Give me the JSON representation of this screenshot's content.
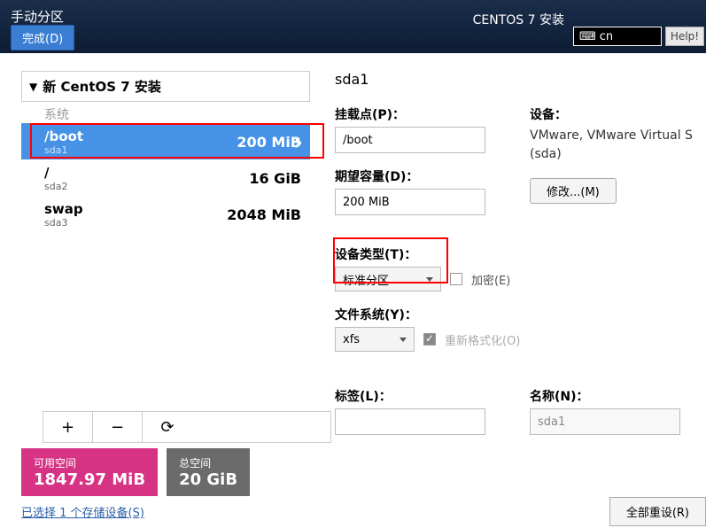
{
  "topbar": {
    "title": "手动分区",
    "done": "完成(D)",
    "installer": "CENTOS 7 安装",
    "lang": "cn",
    "help": "Help!"
  },
  "left": {
    "header": "新 CentOS 7 安装",
    "sys": "系统",
    "parts": [
      {
        "name": "/boot",
        "dev": "sda1",
        "size": "200 MiB",
        "selected": true
      },
      {
        "name": "/",
        "dev": "sda2",
        "size": "16 GiB",
        "selected": false
      },
      {
        "name": "swap",
        "dev": "sda3",
        "size": "2048 MiB",
        "selected": false
      }
    ],
    "toolbar": {
      "add": "+",
      "remove": "−",
      "reload": "⟳"
    }
  },
  "right": {
    "device_title": "sda1",
    "mount_lbl": "挂载点(P)：",
    "mount_val": "/boot",
    "capacity_lbl": "期望容量(D)：",
    "capacity_val": "200 MiB",
    "device_lbl": "设备：",
    "device_info": "VMware, VMware Virtual S (sda)",
    "modify": "修改...(M)",
    "type_lbl": "设备类型(T)：",
    "type_val": "标准分区",
    "encrypt": "加密(E)",
    "fs_lbl": "文件系统(Y)：",
    "fs_val": "xfs",
    "reformat": "重新格式化(O)",
    "label_lbl": "标签(L)：",
    "label_val": "",
    "name_lbl": "名称(N)：",
    "name_val": "sda1"
  },
  "bottom": {
    "avail_lbl": "可用空间",
    "avail_val": "1847.97 MiB",
    "total_lbl": "总空间",
    "total_val": "20 GiB",
    "storage_link": "已选择 1 个存储设备(S)",
    "reset_all": "全部重设(R)"
  }
}
